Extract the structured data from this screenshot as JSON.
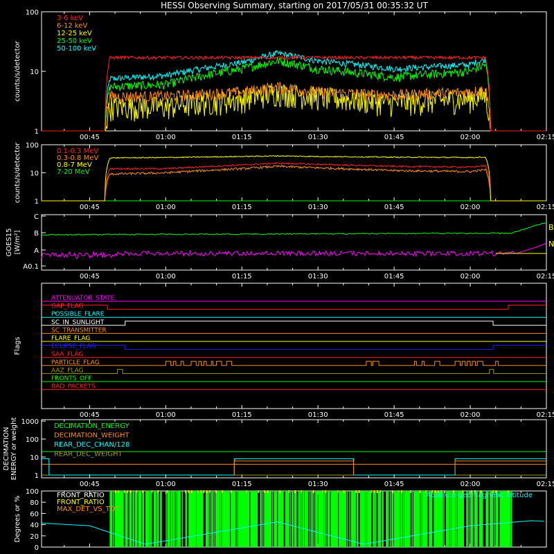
{
  "title": "HESSI Observing Summary, starting on 2017/05/31 00:35:32 UT",
  "colors": {
    "background": "#000000",
    "frame": "#ffffff",
    "red": "#ff2020",
    "orange": "#ff8c1a",
    "yellow": "#ffff00",
    "green": "#00ff00",
    "cyan": "#00ffff",
    "magenta": "#ff00ff",
    "blue": "#2020ff",
    "olive": "#9a9a20",
    "gold": "#ffc400"
  },
  "time_ticks": [
    "00:45",
    "01:00",
    "01:15",
    "01:30",
    "01:45",
    "02:00",
    "02:15"
  ],
  "chart_data": [
    {
      "id": "panel1",
      "type": "line",
      "ylabel": "counts/s/detector",
      "yscale": "log",
      "ylim": [
        1,
        100
      ],
      "yticks": [
        "100",
        "10",
        "1"
      ],
      "xlim": [
        "00:35:32",
        "02:15:00"
      ],
      "series": [
        {
          "name": "3-6 keV",
          "color": "#ff2020",
          "x": [
            "00:35",
            "00:48",
            "00:49",
            "01:00",
            "01:15",
            "01:20",
            "01:30",
            "01:45",
            "02:00",
            "02:03",
            "02:04"
          ],
          "values": [
            1,
            1,
            17,
            17,
            17,
            17,
            17,
            17,
            17,
            17,
            1
          ]
        },
        {
          "name": "6-12 keV",
          "color": "#ff8c1a",
          "x": [
            "00:35",
            "00:48",
            "00:49",
            "01:00",
            "01:15",
            "01:22",
            "01:30",
            "01:45",
            "02:00",
            "02:03",
            "02:04"
          ],
          "values": [
            1,
            1,
            3.8,
            3.8,
            4.5,
            5.5,
            4.5,
            4,
            4.5,
            5,
            1
          ]
        },
        {
          "name": "12-25 keV",
          "color": "#ffff00",
          "x": [
            "00:35",
            "00:48",
            "00:49",
            "01:00",
            "01:15",
            "01:22",
            "01:30",
            "01:45",
            "02:00",
            "02:03",
            "02:04"
          ],
          "values": [
            1,
            1,
            2.6,
            2.6,
            3.5,
            4.5,
            3.8,
            3,
            3.5,
            4,
            1
          ]
        },
        {
          "name": "25-50 keV",
          "color": "#00ff00",
          "x": [
            "00:35",
            "00:48",
            "00:49",
            "01:00",
            "01:15",
            "01:22",
            "01:30",
            "01:45",
            "02:00",
            "02:03",
            "02:04"
          ],
          "values": [
            1,
            1,
            5.5,
            6,
            11,
            15,
            11,
            8,
            10,
            13,
            1
          ]
        },
        {
          "name": "50-100 keV",
          "color": "#00ffff",
          "x": [
            "00:35",
            "00:48",
            "00:49",
            "01:00",
            "01:15",
            "01:22",
            "01:30",
            "01:45",
            "02:00",
            "02:03",
            "02:04"
          ],
          "values": [
            1,
            1,
            7.5,
            8.5,
            14,
            20,
            15,
            11,
            13,
            16,
            1
          ]
        }
      ]
    },
    {
      "id": "panel2",
      "type": "line",
      "ylabel": "counts/s/detector",
      "yscale": "log",
      "ylim": [
        1,
        100
      ],
      "yticks": [
        "100",
        "10",
        "1"
      ],
      "series": [
        {
          "name": "0.1-0.3 MeV",
          "color": "#ff2020",
          "x": [
            "00:35",
            "00:48",
            "00:49",
            "01:00",
            "01:15",
            "01:22",
            "01:30",
            "01:45",
            "02:00",
            "02:03",
            "02:04"
          ],
          "values": [
            1,
            1,
            14,
            14,
            19,
            22,
            20,
            17,
            16,
            18,
            1
          ]
        },
        {
          "name": "0.3-0.8 MeV",
          "color": "#ff8c1a",
          "x": [
            "00:35",
            "00:48",
            "00:49",
            "01:00",
            "01:15",
            "01:22",
            "01:30",
            "01:45",
            "02:00",
            "02:03",
            "02:04"
          ],
          "values": [
            1,
            1,
            9,
            10,
            14,
            17,
            15,
            12,
            11,
            13,
            1
          ]
        },
        {
          "name": "0.8-7 MeV",
          "color": "#ffff00",
          "x": [
            "00:35",
            "00:48",
            "00:49",
            "01:00",
            "01:15",
            "01:22",
            "01:30",
            "01:45",
            "02:00",
            "02:03",
            "02:04"
          ],
          "values": [
            1,
            1,
            34,
            35,
            38,
            40,
            38,
            36,
            35,
            36,
            1
          ]
        },
        {
          "name": "7-20 MeV",
          "color": "#00ff00",
          "x": [
            "00:35",
            "02:15"
          ],
          "values": [
            1,
            1
          ]
        }
      ]
    },
    {
      "id": "panel3",
      "type": "line",
      "ylabel": "GOES15",
      "ylabel2": "[W/m²]",
      "yticks": [
        "C",
        "B",
        "A",
        "A0.1"
      ],
      "series": [
        {
          "name": "B",
          "color": "#00ff00",
          "x": [
            "00:35",
            "01:00",
            "01:30",
            "02:00",
            "02:08",
            "02:12",
            "02:15"
          ],
          "values": [
            "B",
            "B",
            "B",
            "B",
            "B",
            "B",
            "C"
          ]
        },
        {
          "name": "N",
          "color": "#ff00ff",
          "x": [
            "00:35",
            "00:45",
            "01:00",
            "01:30",
            "02:00",
            "02:10",
            "02:15"
          ],
          "values": [
            "A",
            "A",
            "A",
            "A",
            "A",
            "A",
            "B"
          ]
        }
      ],
      "end_labels": [
        "B",
        "N"
      ]
    },
    {
      "id": "panel4",
      "type": "line",
      "ylabel": "Flags",
      "flags": [
        {
          "name": "ATTENUATOR_STATE",
          "color": "#ff00ff"
        },
        {
          "name": "GAP_FLAG",
          "color": "#ff2020"
        },
        {
          "name": "POSSIBLE_FLARE",
          "color": "#00ffff"
        },
        {
          "name": "SC_IN_SUNLIGHT",
          "color": "#ffffff"
        },
        {
          "name": "SC_TRANSMITTER",
          "color": "#ff8c1a"
        },
        {
          "name": "FLARE_FLAG",
          "color": "#ffff00"
        },
        {
          "name": "ECLIPSE_FLAG",
          "color": "#2020ff"
        },
        {
          "name": "SAA_FLAG",
          "color": "#ff2020"
        },
        {
          "name": "PARTICLE_FLAG",
          "color": "#ff8c1a"
        },
        {
          "name": "AAZ_FLAG",
          "color": "#9a9a20"
        },
        {
          "name": "FRONTS_OFF",
          "color": "#00ff00"
        },
        {
          "name": "BAD_PACKETS",
          "color": "#ff2020"
        }
      ]
    },
    {
      "id": "panel5",
      "type": "line",
      "ylabel": "DECIMATION",
      "ylabel2": "ENERGY or weight",
      "yscale": "log",
      "ylim": [
        1,
        1000
      ],
      "yticks": [
        "1000",
        "100",
        "10",
        "1"
      ],
      "series": [
        {
          "name": "DECIMATION_ENERGY",
          "color": "#00ff00",
          "x": [
            "00:35",
            "02:15"
          ],
          "values": [
            20,
            20
          ]
        },
        {
          "name": "DECIMATION_WEIGHT",
          "color": "#ff8c1a",
          "x": [
            "00:35",
            "02:15"
          ],
          "values": [
            4,
            4
          ]
        },
        {
          "name": "REAR_DEC_CHAN/128",
          "color": "#00ffff",
          "x": [
            "00:35",
            "00:37",
            "01:14",
            "01:37",
            "02:04",
            "02:15"
          ],
          "values": [
            8,
            8,
            8,
            8,
            8,
            8
          ]
        },
        {
          "name": "REAR_DEC_WEIGHT",
          "color": "#9a9a20",
          "x": [
            "00:35",
            "02:15"
          ],
          "values": [
            1,
            1
          ]
        }
      ]
    },
    {
      "id": "panel6",
      "type": "line",
      "ylabel": "Degrees or %",
      "ylim": [
        0,
        100
      ],
      "yticks": [
        "100",
        "80",
        "60",
        "40",
        "20",
        "0"
      ],
      "series": [
        {
          "name": "FRONT_RATIO",
          "color": "#ffffff"
        },
        {
          "name": "FRONT_RATIO",
          "color": "#ffff00"
        },
        {
          "name": "MAX_DET_VS_TOT",
          "color": "#ff8c1a"
        },
        {
          "name": "Absolute geomagnetic latitude",
          "color": "#00ffff",
          "x": [
            "00:35",
            "00:45",
            "00:56",
            "01:22",
            "01:39",
            "02:00",
            "02:12",
            "02:15"
          ],
          "values": [
            43,
            38,
            5,
            45,
            5,
            38,
            47,
            46
          ]
        }
      ]
    }
  ]
}
